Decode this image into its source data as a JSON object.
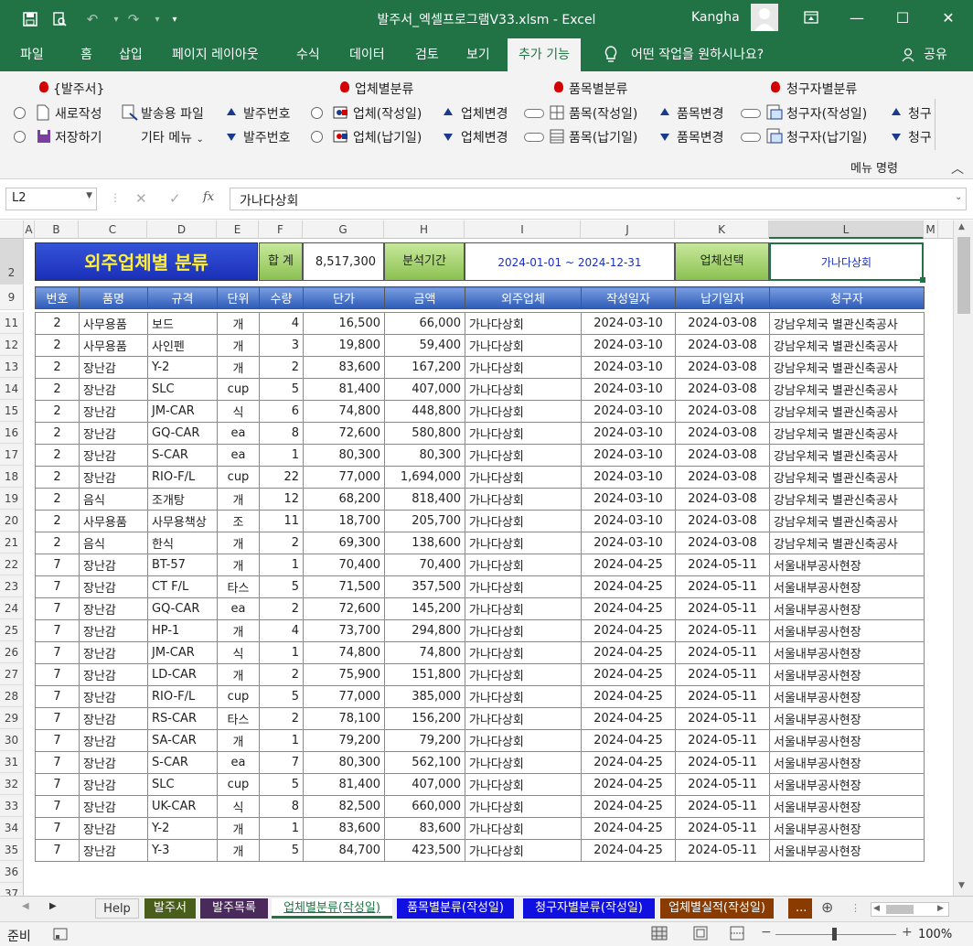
{
  "window": {
    "title": "발주서_엑셀프로그램V33.xlsm  -  Excel",
    "user": "Kangha"
  },
  "ribbon_tabs": [
    "파일",
    "홈",
    "삽입",
    "페이지 레이아웃",
    "수식",
    "데이터",
    "검토",
    "보기",
    "추가 기능"
  ],
  "tell_me": "어떤 작업을 원하시나요?",
  "share": "공유",
  "ribbon": {
    "group1_title": "{발주서}",
    "new": "새로작성",
    "save": "저장하기",
    "send_file": "발송용 파일",
    "other_menu": "기타 메뉴",
    "order_no_up": "발주번호",
    "order_no_down": "발주번호",
    "group2_title": "업체별분류",
    "vendor_write": "업체(작성일)",
    "vendor_due": "업체(납기일)",
    "vendor_change_up": "업체변경",
    "vendor_change_down": "업체변경",
    "group3_title": "품목별분류",
    "item_write": "품목(작성일)",
    "item_due": "품목(납기일)",
    "item_change_up": "품목변경",
    "item_change_down": "품목변경",
    "group4_title": "청구자별분류",
    "req_write": "청구자(작성일)",
    "req_due": "청구자(납기일)",
    "req_trunc_up": "청구",
    "req_trunc_down": "청구",
    "menu_label": "메뉴 명령"
  },
  "formula_bar": {
    "name_box": "L2",
    "fx": "fx",
    "content": "가나다상회"
  },
  "columns": [
    "A",
    "B",
    "C",
    "D",
    "E",
    "F",
    "G",
    "H",
    "I",
    "J",
    "K",
    "L",
    "M"
  ],
  "summary": {
    "banner": "외주업체별 분류",
    "total_label": "합 계",
    "total_value": "8,517,300",
    "period_label": "분석기간",
    "period_value": "2024-01-01  ~  2024-12-31",
    "vendor_select_label": "업체선택",
    "vendor_select_value": "가나다상회"
  },
  "table_headers": [
    "번호",
    "품명",
    "규격",
    "단위",
    "수량",
    "단가",
    "금액",
    "외주업체",
    "작성일자",
    "납기일자",
    "청구자"
  ],
  "row_numbers_top": [
    "2",
    "9"
  ],
  "rows": [
    {
      "r": "11",
      "no": "2",
      "name": "사무용품",
      "spec": "보드",
      "unit": "개",
      "qty": "4",
      "price": "16,500",
      "amount": "66,000",
      "vendor": "가나다상회",
      "written": "2024-03-10",
      "due": "2024-03-08",
      "req": "강남우체국 별관신축공사"
    },
    {
      "r": "12",
      "no": "2",
      "name": "사무용품",
      "spec": "사인펜",
      "unit": "개",
      "qty": "3",
      "price": "19,800",
      "amount": "59,400",
      "vendor": "가나다상회",
      "written": "2024-03-10",
      "due": "2024-03-08",
      "req": "강남우체국 별관신축공사"
    },
    {
      "r": "13",
      "no": "2",
      "name": "장난감",
      "spec": "Y-2",
      "unit": "개",
      "qty": "2",
      "price": "83,600",
      "amount": "167,200",
      "vendor": "가나다상회",
      "written": "2024-03-10",
      "due": "2024-03-08",
      "req": "강남우체국 별관신축공사"
    },
    {
      "r": "14",
      "no": "2",
      "name": "장난감",
      "spec": "SLC",
      "unit": "cup",
      "qty": "5",
      "price": "81,400",
      "amount": "407,000",
      "vendor": "가나다상회",
      "written": "2024-03-10",
      "due": "2024-03-08",
      "req": "강남우체국 별관신축공사"
    },
    {
      "r": "15",
      "no": "2",
      "name": "장난감",
      "spec": "JM-CAR",
      "unit": "식",
      "qty": "6",
      "price": "74,800",
      "amount": "448,800",
      "vendor": "가나다상회",
      "written": "2024-03-10",
      "due": "2024-03-08",
      "req": "강남우체국 별관신축공사"
    },
    {
      "r": "16",
      "no": "2",
      "name": "장난감",
      "spec": "GQ-CAR",
      "unit": "ea",
      "qty": "8",
      "price": "72,600",
      "amount": "580,800",
      "vendor": "가나다상회",
      "written": "2024-03-10",
      "due": "2024-03-08",
      "req": "강남우체국 별관신축공사"
    },
    {
      "r": "17",
      "no": "2",
      "name": "장난감",
      "spec": "S-CAR",
      "unit": "ea",
      "qty": "1",
      "price": "80,300",
      "amount": "80,300",
      "vendor": "가나다상회",
      "written": "2024-03-10",
      "due": "2024-03-08",
      "req": "강남우체국 별관신축공사"
    },
    {
      "r": "18",
      "no": "2",
      "name": "장난감",
      "spec": "RIO-F/L",
      "unit": "cup",
      "qty": "22",
      "price": "77,000",
      "amount": "1,694,000",
      "vendor": "가나다상회",
      "written": "2024-03-10",
      "due": "2024-03-08",
      "req": "강남우체국 별관신축공사"
    },
    {
      "r": "19",
      "no": "2",
      "name": "음식",
      "spec": "조개탕",
      "unit": "개",
      "qty": "12",
      "price": "68,200",
      "amount": "818,400",
      "vendor": "가나다상회",
      "written": "2024-03-10",
      "due": "2024-03-08",
      "req": "강남우체국 별관신축공사"
    },
    {
      "r": "20",
      "no": "2",
      "name": "사무용품",
      "spec": "사무용책상",
      "unit": "조",
      "qty": "11",
      "price": "18,700",
      "amount": "205,700",
      "vendor": "가나다상회",
      "written": "2024-03-10",
      "due": "2024-03-08",
      "req": "강남우체국 별관신축공사"
    },
    {
      "r": "21",
      "no": "2",
      "name": "음식",
      "spec": "한식",
      "unit": "개",
      "qty": "2",
      "price": "69,300",
      "amount": "138,600",
      "vendor": "가나다상회",
      "written": "2024-03-10",
      "due": "2024-03-08",
      "req": "강남우체국 별관신축공사"
    },
    {
      "r": "22",
      "no": "7",
      "name": "장난감",
      "spec": "BT-57",
      "unit": "개",
      "qty": "1",
      "price": "70,400",
      "amount": "70,400",
      "vendor": "가나다상회",
      "written": "2024-04-25",
      "due": "2024-05-11",
      "req": "서울내부공사현장"
    },
    {
      "r": "23",
      "no": "7",
      "name": "장난감",
      "spec": "CT F/L",
      "unit": "타스",
      "qty": "5",
      "price": "71,500",
      "amount": "357,500",
      "vendor": "가나다상회",
      "written": "2024-04-25",
      "due": "2024-05-11",
      "req": "서울내부공사현장"
    },
    {
      "r": "24",
      "no": "7",
      "name": "장난감",
      "spec": "GQ-CAR",
      "unit": "ea",
      "qty": "2",
      "price": "72,600",
      "amount": "145,200",
      "vendor": "가나다상회",
      "written": "2024-04-25",
      "due": "2024-05-11",
      "req": "서울내부공사현장"
    },
    {
      "r": "25",
      "no": "7",
      "name": "장난감",
      "spec": "HP-1",
      "unit": "개",
      "qty": "4",
      "price": "73,700",
      "amount": "294,800",
      "vendor": "가나다상회",
      "written": "2024-04-25",
      "due": "2024-05-11",
      "req": "서울내부공사현장"
    },
    {
      "r": "26",
      "no": "7",
      "name": "장난감",
      "spec": "JM-CAR",
      "unit": "식",
      "qty": "1",
      "price": "74,800",
      "amount": "74,800",
      "vendor": "가나다상회",
      "written": "2024-04-25",
      "due": "2024-05-11",
      "req": "서울내부공사현장"
    },
    {
      "r": "27",
      "no": "7",
      "name": "장난감",
      "spec": "LD-CAR",
      "unit": "개",
      "qty": "2",
      "price": "75,900",
      "amount": "151,800",
      "vendor": "가나다상회",
      "written": "2024-04-25",
      "due": "2024-05-11",
      "req": "서울내부공사현장"
    },
    {
      "r": "28",
      "no": "7",
      "name": "장난감",
      "spec": "RIO-F/L",
      "unit": "cup",
      "qty": "5",
      "price": "77,000",
      "amount": "385,000",
      "vendor": "가나다상회",
      "written": "2024-04-25",
      "due": "2024-05-11",
      "req": "서울내부공사현장"
    },
    {
      "r": "29",
      "no": "7",
      "name": "장난감",
      "spec": "RS-CAR",
      "unit": "타스",
      "qty": "2",
      "price": "78,100",
      "amount": "156,200",
      "vendor": "가나다상회",
      "written": "2024-04-25",
      "due": "2024-05-11",
      "req": "서울내부공사현장"
    },
    {
      "r": "30",
      "no": "7",
      "name": "장난감",
      "spec": "SA-CAR",
      "unit": "개",
      "qty": "1",
      "price": "79,200",
      "amount": "79,200",
      "vendor": "가나다상회",
      "written": "2024-04-25",
      "due": "2024-05-11",
      "req": "서울내부공사현장"
    },
    {
      "r": "31",
      "no": "7",
      "name": "장난감",
      "spec": "S-CAR",
      "unit": "ea",
      "qty": "7",
      "price": "80,300",
      "amount": "562,100",
      "vendor": "가나다상회",
      "written": "2024-04-25",
      "due": "2024-05-11",
      "req": "서울내부공사현장"
    },
    {
      "r": "32",
      "no": "7",
      "name": "장난감",
      "spec": "SLC",
      "unit": "cup",
      "qty": "5",
      "price": "81,400",
      "amount": "407,000",
      "vendor": "가나다상회",
      "written": "2024-04-25",
      "due": "2024-05-11",
      "req": "서울내부공사현장"
    },
    {
      "r": "33",
      "no": "7",
      "name": "장난감",
      "spec": "UK-CAR",
      "unit": "식",
      "qty": "8",
      "price": "82,500",
      "amount": "660,000",
      "vendor": "가나다상회",
      "written": "2024-04-25",
      "due": "2024-05-11",
      "req": "서울내부공사현장"
    },
    {
      "r": "34",
      "no": "7",
      "name": "장난감",
      "spec": "Y-2",
      "unit": "개",
      "qty": "1",
      "price": "83,600",
      "amount": "83,600",
      "vendor": "가나다상회",
      "written": "2024-04-25",
      "due": "2024-05-11",
      "req": "서울내부공사현장"
    },
    {
      "r": "35",
      "no": "7",
      "name": "장난감",
      "spec": "Y-3",
      "unit": "개",
      "qty": "5",
      "price": "84,700",
      "amount": "423,500",
      "vendor": "가나다상회",
      "written": "2024-04-25",
      "due": "2024-05-11",
      "req": "서울내부공사현장"
    }
  ],
  "trailing_rows": [
    "36",
    "37"
  ],
  "sheet_tabs": [
    {
      "label": "Help",
      "color": "#f0f0f0",
      "text": "#333"
    },
    {
      "label": "발주서",
      "color": "#4a5e1c",
      "text": "#ffffff"
    },
    {
      "label": "발주목록",
      "color": "#4a2a5a",
      "text": "#ffffff"
    },
    {
      "label": "업체별분류(작성일)",
      "color": "#ffffff",
      "text": "#217346"
    },
    {
      "label": "품목별분류(작성일)",
      "color": "#1010e0",
      "text": "#ffffff"
    },
    {
      "label": "청구자별분류(작성일)",
      "color": "#1010e0",
      "text": "#ffffff"
    },
    {
      "label": "업체별실적(작성일)",
      "color": "#8a3b00",
      "text": "#ffffff"
    },
    {
      "label": "...",
      "color": "#8a3b00",
      "text": "#ffffff"
    }
  ],
  "status": {
    "ready": "준비",
    "zoom": "100%"
  },
  "colors": {
    "excel_green": "#217346",
    "banner_blue": "#1a2fb8",
    "banner_text": "#ffef3a",
    "header_blue": "#2d5bb8",
    "period_text": "#1a2fb8"
  }
}
